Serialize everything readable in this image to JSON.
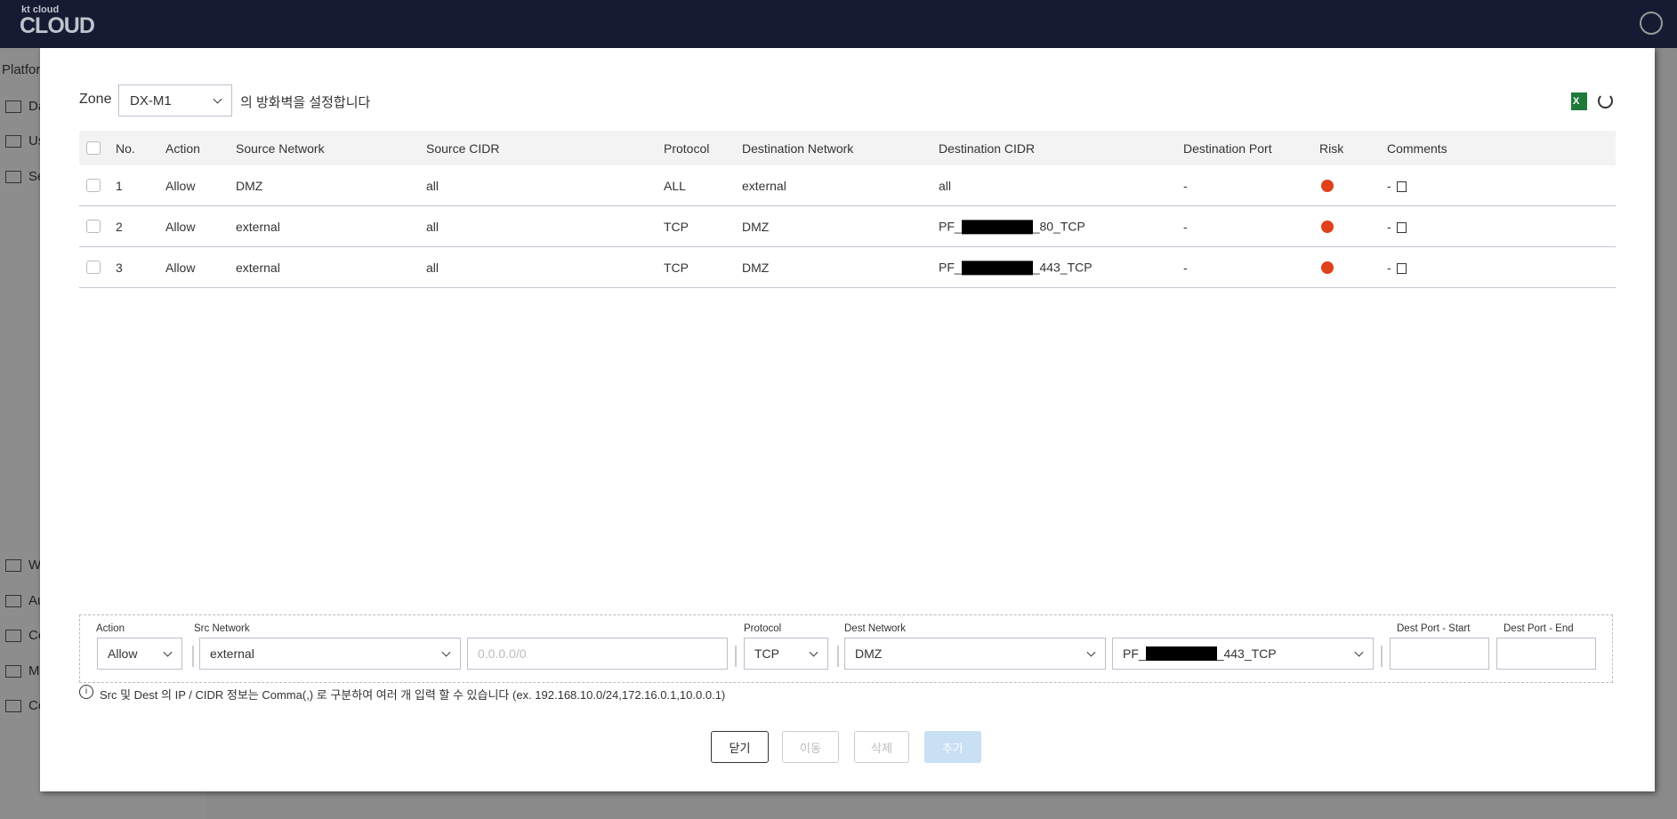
{
  "header": {
    "logo_small": "kt cloud",
    "logo_big": "CLOUD",
    "user_icon": "user-circle-icon"
  },
  "sidebar": {
    "items": [
      {
        "label": "Platfor"
      },
      {
        "label": "Da"
      },
      {
        "label": "Us"
      },
      {
        "label": "Se"
      },
      {
        "label": "Wa"
      },
      {
        "label": "Au"
      },
      {
        "label": "Ce"
      },
      {
        "label": "Me"
      },
      {
        "label": "Co"
      }
    ]
  },
  "modal": {
    "zone_label": "Zone",
    "zone_value": "DX-M1",
    "zone_suffix": "의 방화벽을 설정합니다",
    "icons": {
      "excel": "excel-icon",
      "refresh": "refresh-icon"
    },
    "columns": [
      "No.",
      "Action",
      "Source Network",
      "Source CIDR",
      "Protocol",
      "Destination Network",
      "Destination CIDR",
      "Destination Port",
      "Risk",
      "Comments"
    ],
    "rows": [
      {
        "no": "1",
        "action": "Allow",
        "src_net": "DMZ",
        "src_cidr": "all",
        "protocol": "ALL",
        "dest_net": "external",
        "dest_cidr_prefix": "all",
        "dest_cidr_suffix": "",
        "dest_port": "-",
        "risk": "high",
        "risk_color": "#e0401a",
        "comments": "-"
      },
      {
        "no": "2",
        "action": "Allow",
        "src_net": "external",
        "src_cidr": "all",
        "protocol": "TCP",
        "dest_net": "DMZ",
        "dest_cidr_prefix": "PF_",
        "dest_cidr_suffix": "_80_TCP",
        "dest_port": "-",
        "risk": "high",
        "risk_color": "#e0401a",
        "comments": "-"
      },
      {
        "no": "3",
        "action": "Allow",
        "src_net": "external",
        "src_cidr": "all",
        "protocol": "TCP",
        "dest_net": "DMZ",
        "dest_cidr_prefix": "PF_",
        "dest_cidr_suffix": "_443_TCP",
        "dest_port": "-",
        "risk": "high",
        "risk_color": "#e0401a",
        "comments": "-"
      }
    ],
    "form": {
      "action_label": "Action",
      "action_value": "Allow",
      "src_label": "Src Network",
      "src_value": "external",
      "src_cidr_placeholder": "0.0.0.0/0",
      "protocol_label": "Protocol",
      "protocol_value": "TCP",
      "dest_label": "Dest Network",
      "dest_value": "DMZ",
      "dest_cidr_prefix": "PF_",
      "dest_cidr_suffix": "_443_TCP",
      "port_start_label": "Dest Port - Start",
      "port_end_label": "Dest Port - End"
    },
    "info": "Src 및 Dest 의 IP / CIDR 정보는 Comma(,) 로 구분하여 여러 개 입력 할 수 있습니다 (ex. 192.168.10.0/24,172.16.0.1,10.0.0.1)",
    "buttons": {
      "close": "닫기",
      "move": "이동",
      "delete": "삭제",
      "add": "추가"
    }
  }
}
